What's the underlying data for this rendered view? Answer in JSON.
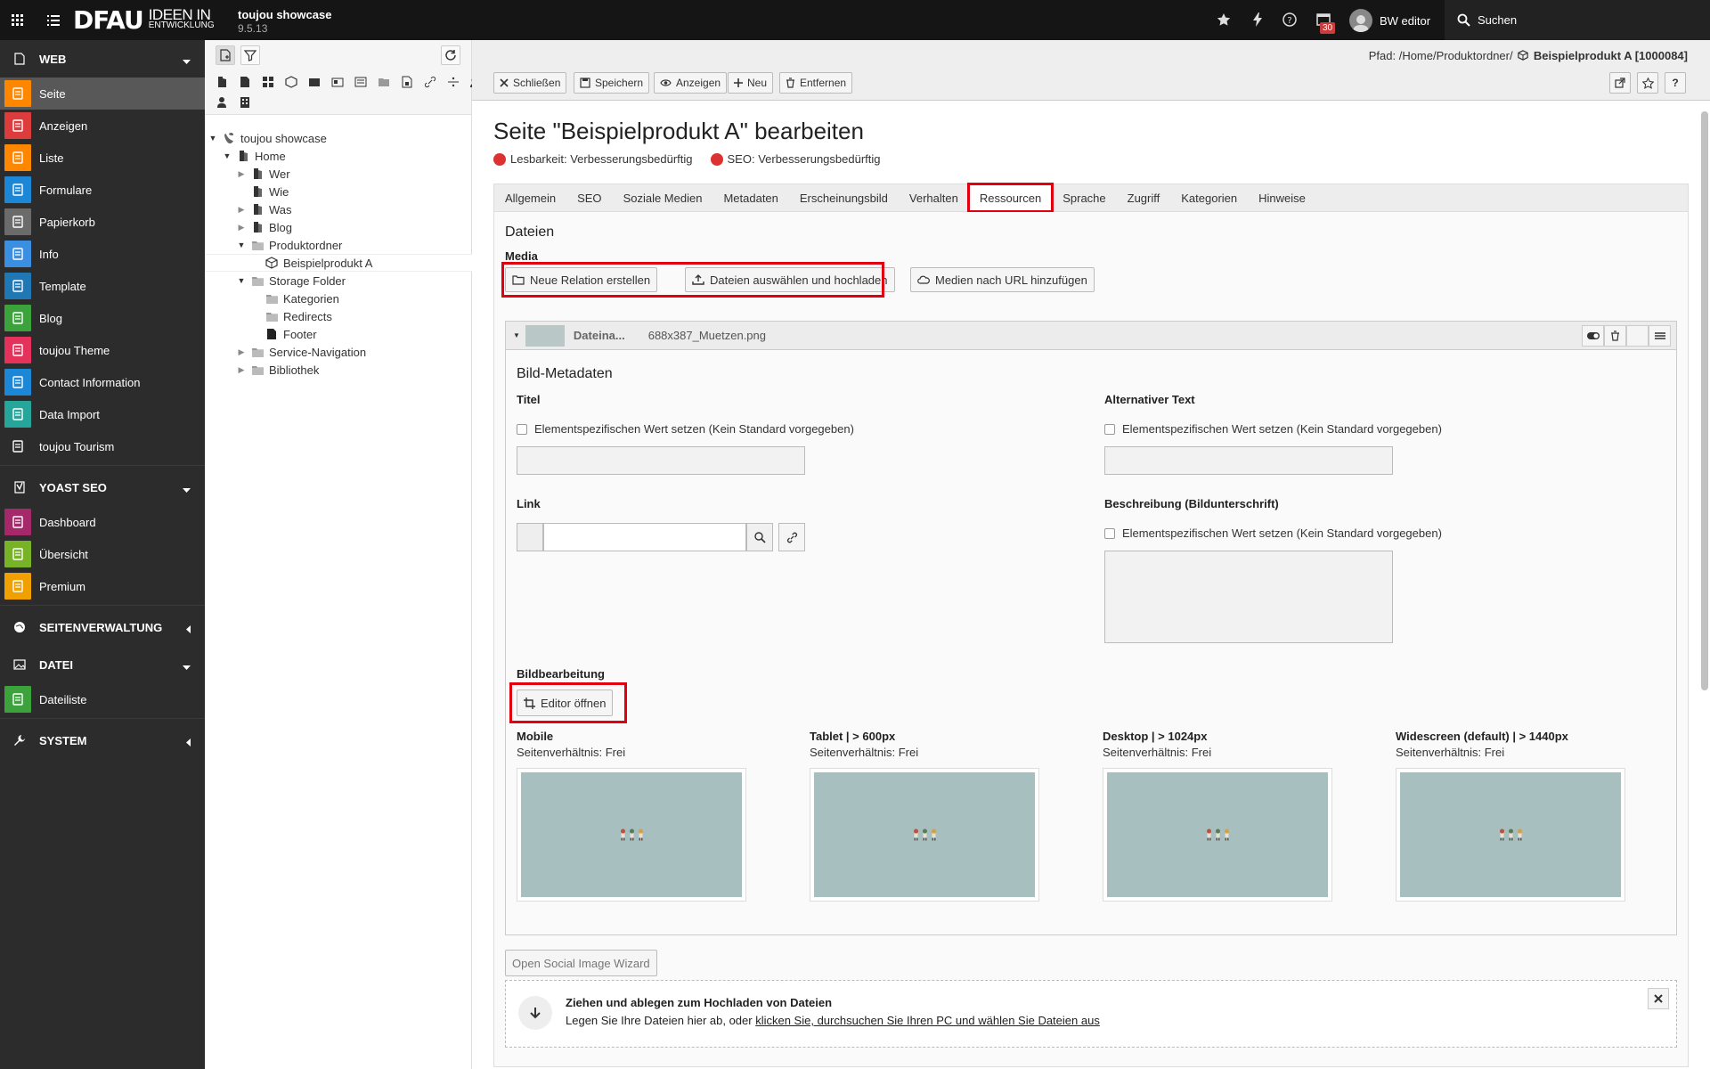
{
  "topbar": {
    "logo_main": "DFAU",
    "logo_line1": "IDEEN IN",
    "logo_line2": "ENTWICKLUNG",
    "site_name": "toujou showcase",
    "version": "9.5.13",
    "notification_count": "30",
    "user_name": "BW editor",
    "search_label": "Suchen"
  },
  "module_menu": {
    "groups": [
      {
        "label": "WEB",
        "items": [
          {
            "label": "Seite",
            "color": "#ff8700",
            "active": true
          },
          {
            "label": "Anzeigen",
            "color": "#dc3c3c"
          },
          {
            "label": "Liste",
            "color": "#ff8700"
          },
          {
            "label": "Formulare",
            "color": "#1b87d6"
          },
          {
            "label": "Papierkorb",
            "color": "#6b6b6b"
          },
          {
            "label": "Info",
            "color": "#3b8fe0"
          },
          {
            "label": "Template",
            "color": "#1f77b4"
          },
          {
            "label": "Blog",
            "color": "#3ca23c"
          },
          {
            "label": "toujou Theme",
            "color": "#e5325a"
          },
          {
            "label": "Contact Information",
            "color": "#1b87d6"
          },
          {
            "label": "Data Import",
            "color": "#26a69a"
          },
          {
            "label": "toujou Tourism",
            "color": "#2c2c2c"
          }
        ]
      },
      {
        "label": "YOAST SEO",
        "items": [
          {
            "label": "Dashboard",
            "color": "#a4286a"
          },
          {
            "label": "Übersicht",
            "color": "#77b227"
          },
          {
            "label": "Premium",
            "color": "#f0a000"
          }
        ]
      },
      {
        "label": "SEITENVERWALTUNG",
        "items": []
      },
      {
        "label": "DATEI",
        "items": [
          {
            "label": "Dateiliste",
            "color": "#3ca23c"
          }
        ]
      },
      {
        "label": "SYSTEM",
        "items": []
      }
    ]
  },
  "tree": {
    "nodes": [
      {
        "label": "toujou showcase"
      },
      {
        "label": "Home"
      },
      {
        "label": "Wer"
      },
      {
        "label": "Wie"
      },
      {
        "label": "Was"
      },
      {
        "label": "Blog"
      },
      {
        "label": "Produktordner"
      },
      {
        "label": "Beispielprodukt A"
      },
      {
        "label": "Storage Folder"
      },
      {
        "label": "Kategorien"
      },
      {
        "label": "Redirects"
      },
      {
        "label": "Footer"
      },
      {
        "label": "Service-Navigation"
      },
      {
        "label": "Bibliothek"
      }
    ]
  },
  "docheader": {
    "path_prefix": "Pfad: /Home/Produktordner/",
    "path_record": "Beispielprodukt A [1000084]",
    "buttons": {
      "close": "Schließen",
      "save": "Speichern",
      "view": "Anzeigen",
      "new": "Neu",
      "delete": "Entfernen"
    },
    "help": "?"
  },
  "page": {
    "title": "Seite \"Beispielprodukt A\" bearbeiten",
    "readability": "Lesbarkeit: Verbesserungsbedürftig",
    "seo": "SEO: Verbesserungsbedürftig",
    "tabs": [
      "Allgemein",
      "SEO",
      "Soziale Medien",
      "Metadaten",
      "Erscheinungsbild",
      "Verhalten",
      "Ressourcen",
      "Sprache",
      "Zugriff",
      "Kategorien",
      "Hinweise"
    ],
    "active_tab": "Ressourcen"
  },
  "resources": {
    "section": "Dateien",
    "media_label": "Media",
    "btn_new_relation": "Neue Relation erstellen",
    "btn_upload": "Dateien auswählen und hochladen",
    "btn_url": "Medien nach URL hinzufügen",
    "file": {
      "name_short": "Dateina...",
      "filename": "688x387_Muetzen.png"
    },
    "meta_title": "Bild-Metadaten",
    "titel_label": "Titel",
    "alt_label": "Alternativer Text",
    "override_text": "Elementspezifischen Wert setzen (Kein Standard vorgegeben)",
    "link_label": "Link",
    "desc_label": "Beschreibung (Bildunterschrift)",
    "edit_label": "Bildbearbeitung",
    "editor_btn": "Editor öffnen",
    "crops": [
      {
        "title": "Mobile",
        "ratio": "Seitenverhältnis: Frei"
      },
      {
        "title": "Tablet | > 600px",
        "ratio": "Seitenverhältnis: Frei"
      },
      {
        "title": "Desktop | > 1024px",
        "ratio": "Seitenverhältnis: Frei"
      },
      {
        "title": "Widescreen (default) | > 1440px",
        "ratio": "Seitenverhältnis: Frei"
      }
    ],
    "social_btn": "Open Social Image Wizard",
    "dropzone_title": "Ziehen und ablegen zum Hochladen von Dateien",
    "dropzone_text": "Legen Sie Ihre Dateien hier ab, oder ",
    "dropzone_link": "klicken Sie, durchsuchen Sie Ihren PC und wählen Sie Dateien aus"
  }
}
